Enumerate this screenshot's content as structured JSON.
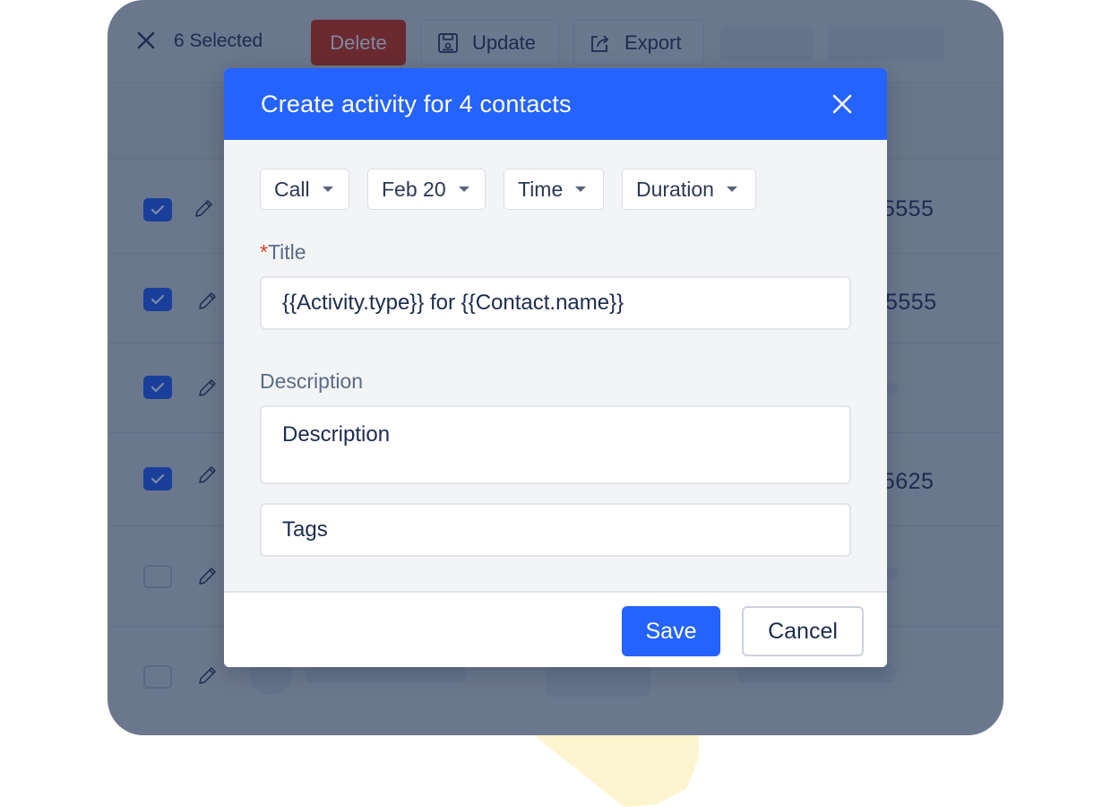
{
  "toolbar": {
    "selected_count_label": "6 Selected",
    "delete_label": "Delete",
    "update_label": "Update",
    "export_label": "Export"
  },
  "rows": [
    {
      "checked": true,
      "phone": "-5555"
    },
    {
      "checked": true,
      "phone": "5555"
    },
    {
      "checked": true,
      "phone": ""
    },
    {
      "checked": true,
      "phone": "-5625"
    },
    {
      "checked": false,
      "phone": ""
    },
    {
      "checked": false,
      "phone": ""
    }
  ],
  "modal": {
    "title": "Create activity for 4 contacts",
    "dropdowns": {
      "type": "Call",
      "date": "Feb 20",
      "time": "Time",
      "duration": "Duration"
    },
    "title_field": {
      "required_marker": "*",
      "label": "Title",
      "value": "{{Activity.type}} for {{Contact.name}}"
    },
    "description_field": {
      "label": "Description",
      "placeholder": "Description"
    },
    "tags_field": {
      "placeholder": "Tags"
    },
    "save_label": "Save",
    "cancel_label": "Cancel"
  },
  "colors": {
    "accent": "#2563ff",
    "overlay": "#6b778c",
    "delete": "#6a2a30",
    "required": "#e33b1d"
  }
}
